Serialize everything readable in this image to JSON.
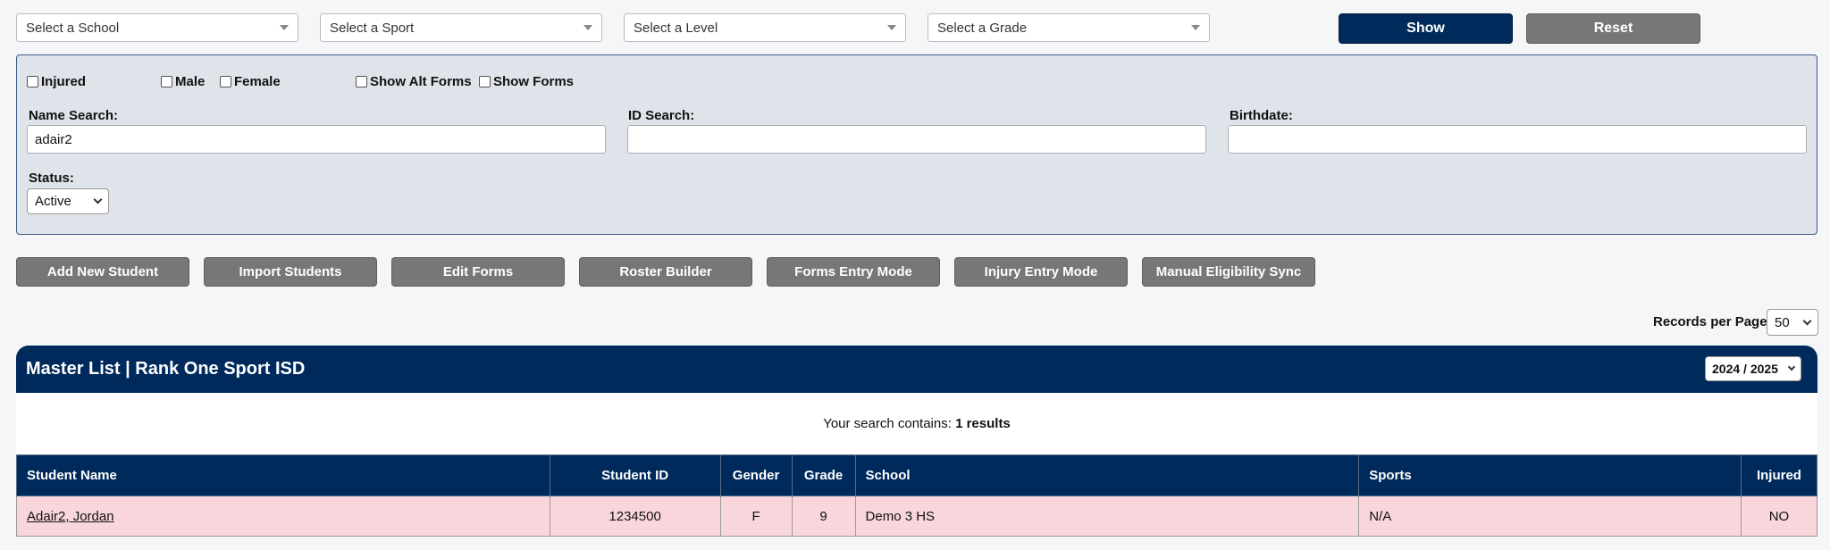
{
  "filters": {
    "school": "Select a School",
    "sport": "Select a Sport",
    "level": "Select a Level",
    "grade": "Select a Grade",
    "show_label": "Show",
    "reset_label": "Reset"
  },
  "panel": {
    "checkboxes": {
      "injured": "Injured",
      "male": "Male",
      "female": "Female",
      "alt_forms": "Show Alt Forms",
      "forms": "Show Forms"
    },
    "name_search_label": "Name Search:",
    "name_search_value": "adair2",
    "id_search_label": "ID Search:",
    "id_search_value": "",
    "birthdate_label": "Birthdate:",
    "birthdate_value": "",
    "status_label": "Status:",
    "status_value": "Active"
  },
  "actions": [
    "Add New Student",
    "Import Students",
    "Edit Forms",
    "Roster Builder",
    "Forms Entry Mode",
    "Injury Entry Mode",
    "Manual Eligibility Sync"
  ],
  "records": {
    "label": "Records per Page:",
    "value": "50"
  },
  "master": {
    "title": "Master List | Rank One Sport ISD",
    "year": "2024 / 2025"
  },
  "results": {
    "prefix": "Your search contains:",
    "count": "1 results"
  },
  "table": {
    "headers": [
      "Student Name",
      "Student ID",
      "Gender",
      "Grade",
      "School",
      "Sports",
      "Injured"
    ],
    "rows": [
      [
        "Adair2, Jordan",
        "1234500",
        "F",
        "9",
        "Demo 3 HS",
        "N/A",
        "NO"
      ]
    ]
  },
  "colors": {
    "navy": "#002a5c",
    "gray_button": "#777777",
    "row_highlight": "#f9d6dc",
    "panel_bg": "#dfe3ea"
  }
}
